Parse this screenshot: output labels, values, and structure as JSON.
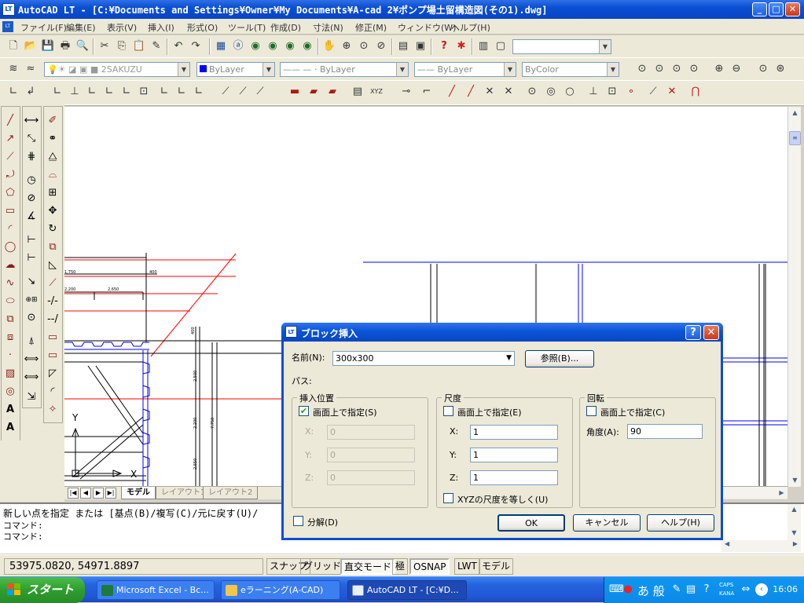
{
  "window": {
    "title": "AutoCAD LT - [C:¥Documents and Settings¥Owner¥My Documents¥A-cad 2¥ポンプ場土留構造図(その1).dwg]",
    "app_icon": "LT"
  },
  "menu": [
    "ファイル(F)",
    "編集(E)",
    "表示(V)",
    "挿入(I)",
    "形式(O)",
    "ツール(T)",
    "作成(D)",
    "寸法(N)",
    "修正(M)",
    "ウィンドウ(W)",
    "ヘルプ(H)"
  ],
  "toolbar2": {
    "layer": "2SAKUZU",
    "color": "ByLayer",
    "linetype": "ByLayer",
    "lineweight": "ByLayer",
    "plotstyle": "ByColor"
  },
  "drawing": {
    "dims": [
      "1,750",
      "2,200",
      "2,650",
      "400",
      "400",
      "2,500",
      "2,200",
      "2,650",
      "7,750"
    ],
    "y_axis": "Y",
    "x_axis": "X"
  },
  "tabs": [
    "モデル",
    "レイアウト1",
    "レイアウト2"
  ],
  "command": [
    "新しい点を指定 または [基点(B)/複写(C)/元に戻す(U)/",
    "コマンド:",
    "コマンド:"
  ],
  "status": {
    "coords": "53975.0820, 54971.8897",
    "buttons": [
      "スナップ",
      "グリッド",
      "直交モード",
      "極",
      "OSNAP",
      "LWT",
      "モデル"
    ]
  },
  "dialog": {
    "title": "ブロック挿入",
    "name_label": "名前(N):",
    "name_value": "300x300",
    "browse": "参照(B)...",
    "path_label": "パス:",
    "insert": {
      "title": "挿入位置",
      "onscreen": "画面上で指定(S)",
      "onscreen_checked": true,
      "x_label": "X:",
      "y_label": "Y:",
      "z_label": "Z:",
      "x": "0",
      "y": "0",
      "z": "0"
    },
    "scale": {
      "title": "尺度",
      "onscreen": "画面上で指定(E)",
      "x_label": "X:",
      "y_label": "Y:",
      "z_label": "Z:",
      "x": "1",
      "y": "1",
      "z": "1",
      "uniform": "XYZの尺度を等しく(U)"
    },
    "rotation": {
      "title": "回転",
      "onscreen": "画面上で指定(C)",
      "angle_label": "角度(A):",
      "angle": "90"
    },
    "explode": "分解(D)",
    "ok": "OK",
    "cancel": "キャンセル",
    "help": "ヘルプ(H)"
  },
  "taskbar": {
    "start": "スタート",
    "tasks": [
      "Microsoft Excel - Bc...",
      "eラーニング(A-CAD)",
      "AutoCAD LT - [C:¥D..."
    ],
    "clock": "16:06",
    "ime": "あ 般",
    "caps": "CAPS",
    "kana": "KANA"
  }
}
